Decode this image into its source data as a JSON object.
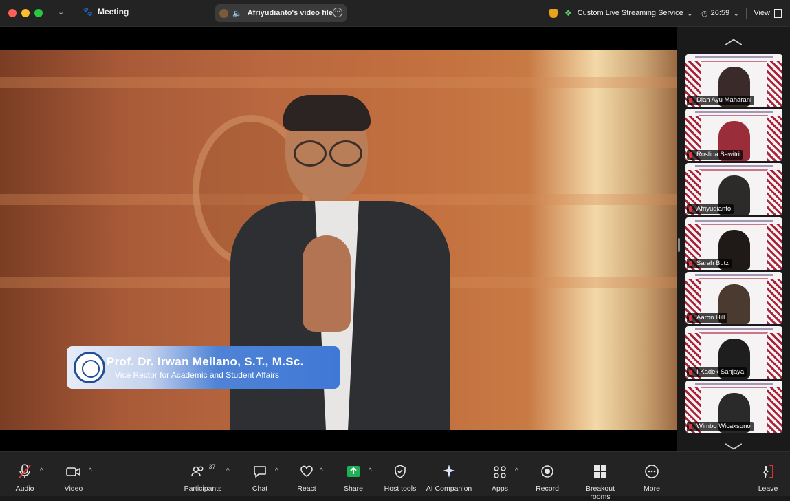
{
  "titlebar": {
    "meeting_label": "Meeting",
    "share_label": "Afriyudianto's video file",
    "service_label": "Custom Live Streaming Service",
    "timer": "26:59",
    "view_label": "View"
  },
  "video": {
    "lower_third_name": "Prof. Dr. Irwan Meilano, S.T., M.Sc.",
    "lower_third_title": "Vice Rector for Academic and Student Affairs"
  },
  "gallery": {
    "participants": [
      {
        "name": "Diah Ayu Maharani",
        "face": "#3a2a2a"
      },
      {
        "name": "Roslina Sawitri",
        "face": "#9b2c3a"
      },
      {
        "name": "Afriyudianto",
        "face": "#2d2a2a"
      },
      {
        "name": "Sarah Butz",
        "face": "#1f1a18"
      },
      {
        "name": "Aaron Hill",
        "face": "#4a3a30"
      },
      {
        "name": "I Kadek Sanjaya",
        "face": "#1e1e1e"
      },
      {
        "name": "Wimbo Wicaksono",
        "face": "#2a2a2a"
      }
    ]
  },
  "toolbar": {
    "audio": "Audio",
    "video": "Video",
    "participants": "Participants",
    "participants_count": "37",
    "chat": "Chat",
    "react": "React",
    "share": "Share",
    "host_tools": "Host tools",
    "ai_companion": "AI Companion",
    "apps": "Apps",
    "record": "Record",
    "breakout_rooms": "Breakout rooms",
    "more": "More",
    "leave": "Leave"
  },
  "colors": {
    "share_green": "#1fb157",
    "leave_red": "#e2373e",
    "muted_red": "#e2373e"
  }
}
